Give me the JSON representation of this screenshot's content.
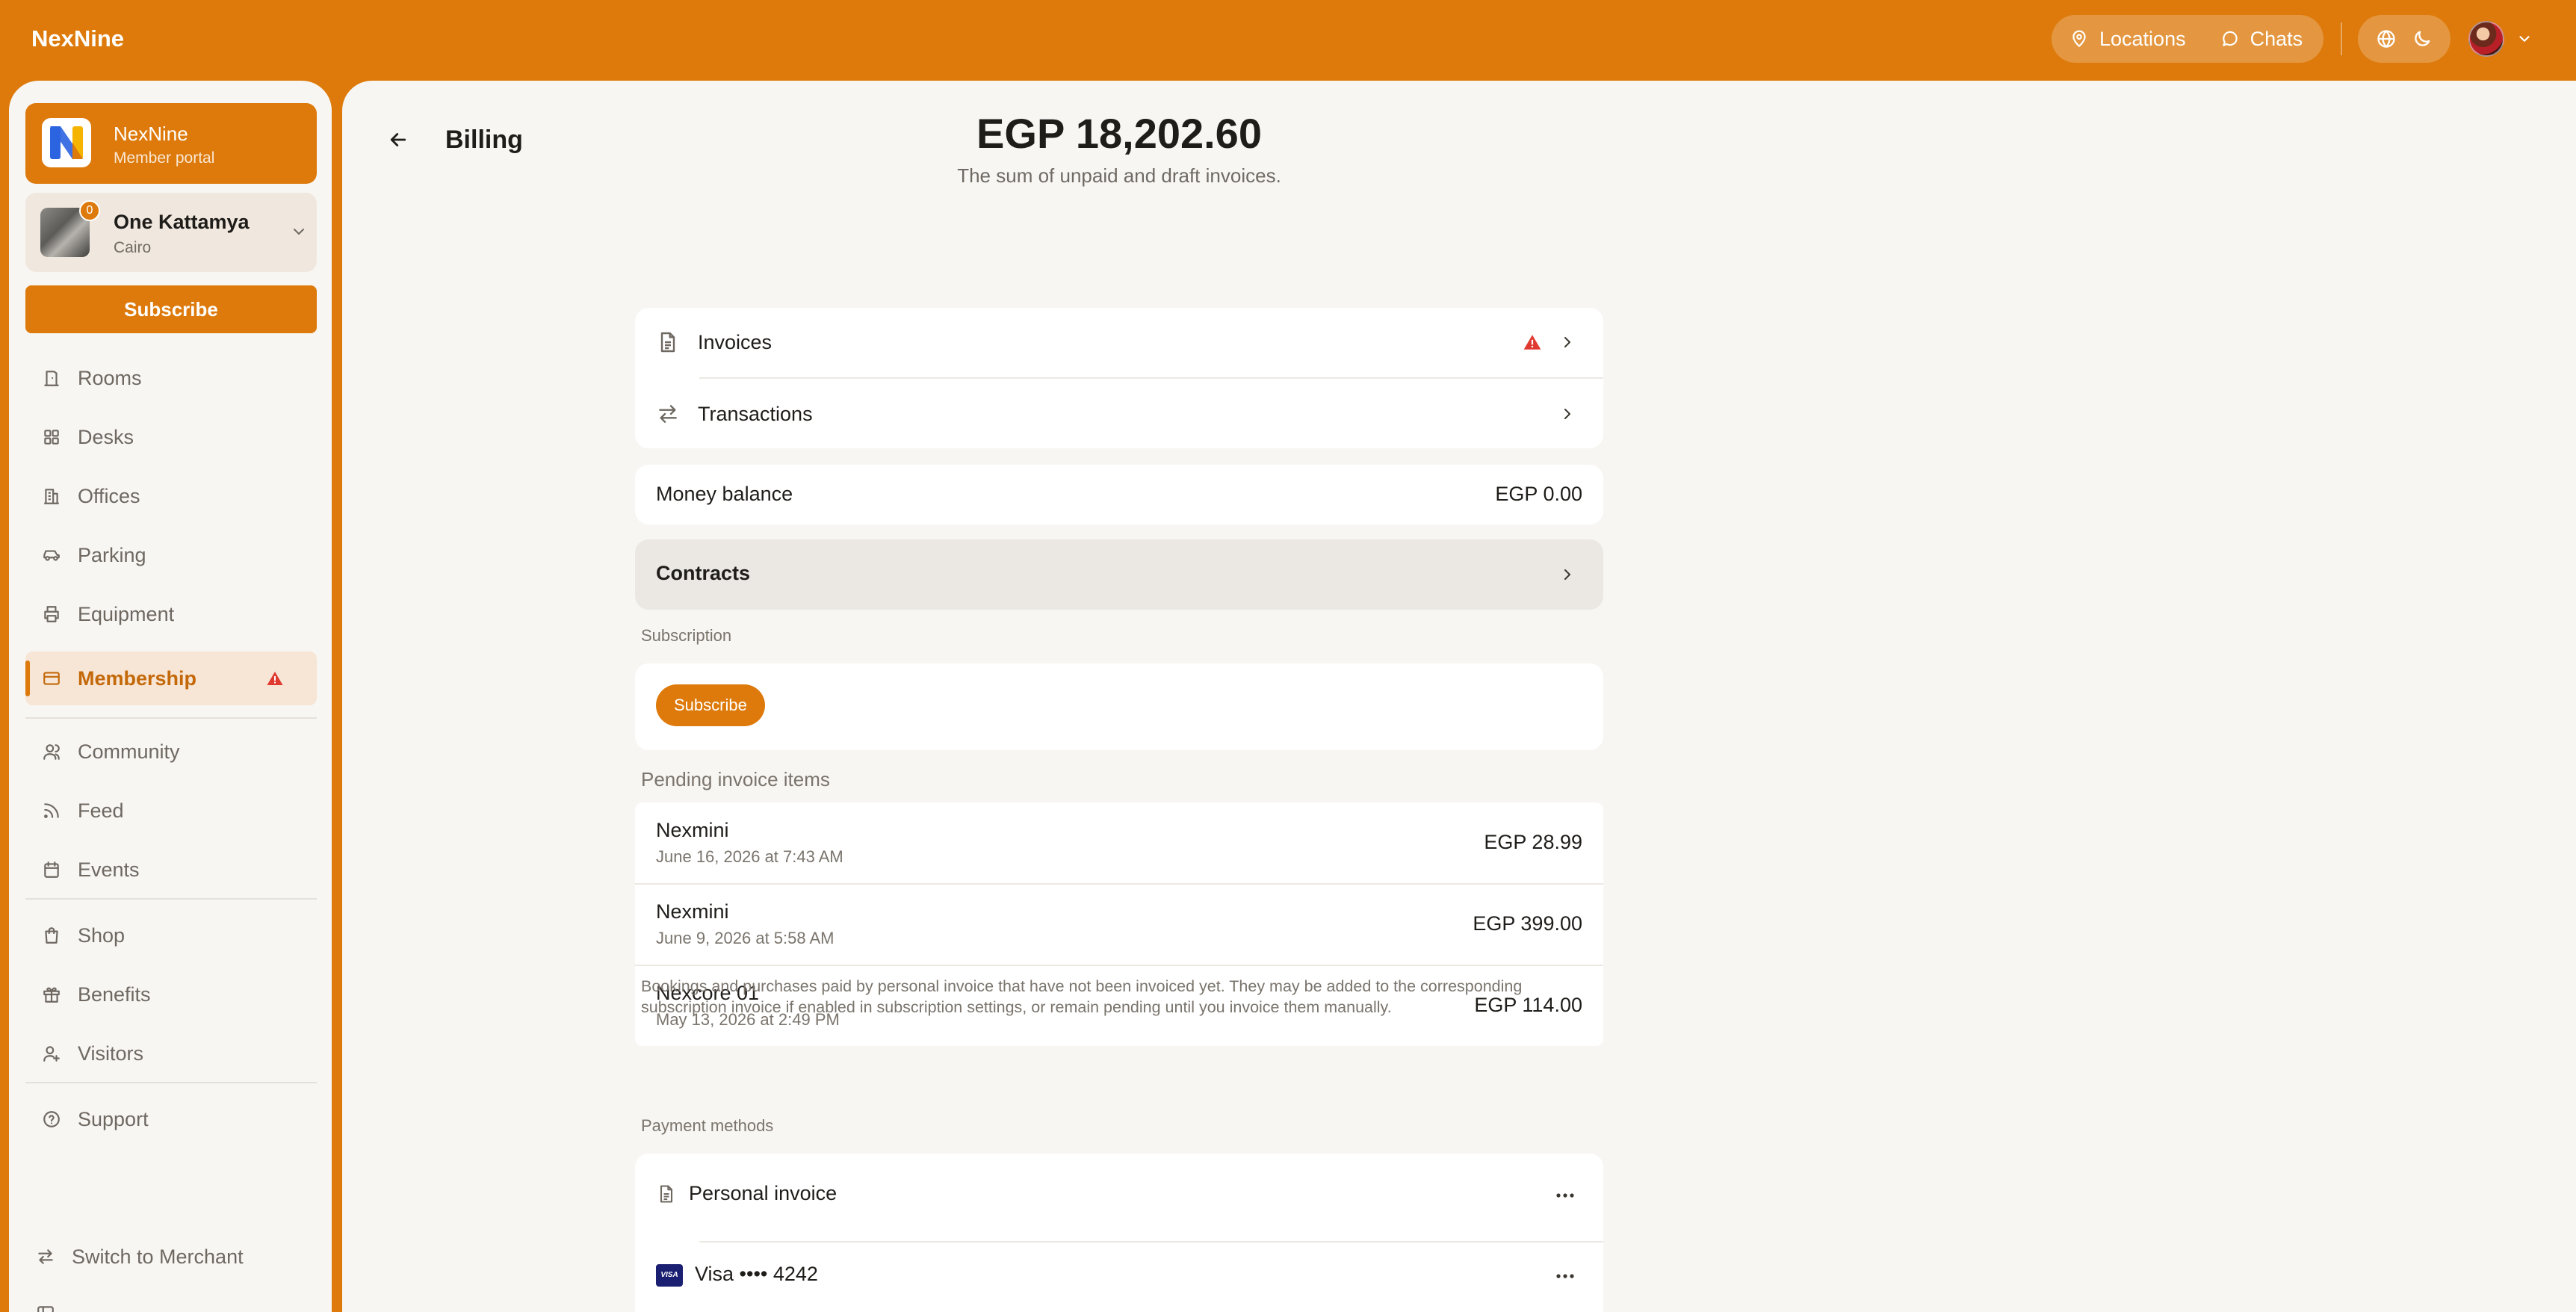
{
  "topbar": {
    "brand": "NexNine",
    "nav": [
      {
        "label": "Locations",
        "icon": "map-pin-icon"
      },
      {
        "label": "Chats",
        "icon": "chat-bubble-icon"
      }
    ],
    "tools": [
      {
        "icon": "globe-icon"
      },
      {
        "icon": "moon-icon"
      }
    ],
    "user_icon": "chevron-down-icon"
  },
  "sidebar": {
    "org": {
      "name": "NexNine",
      "subtitle": "Member portal"
    },
    "location": {
      "name": "One Kattamya",
      "city": "Cairo",
      "badge": "0"
    },
    "subscribe_label": "Subscribe",
    "items": [
      {
        "label": "Rooms",
        "icon": "door-icon"
      },
      {
        "label": "Desks",
        "icon": "grid-icon"
      },
      {
        "label": "Offices",
        "icon": "building-icon"
      },
      {
        "label": "Parking",
        "icon": "car-icon"
      },
      {
        "label": "Equipment",
        "icon": "printer-icon"
      },
      {
        "label": "Membership",
        "icon": "card-icon",
        "active": true,
        "warning": true
      },
      {
        "label": "Community",
        "icon": "users-icon"
      },
      {
        "label": "Feed",
        "icon": "rss-icon"
      },
      {
        "label": "Events",
        "icon": "calendar-icon"
      },
      {
        "label": "Shop",
        "icon": "shopping-bag-icon"
      },
      {
        "label": "Benefits",
        "icon": "gift-icon"
      },
      {
        "label": "Visitors",
        "icon": "user-plus-icon"
      },
      {
        "label": "Support",
        "icon": "help-circle-icon"
      }
    ],
    "switch_label": "Switch to Merchant"
  },
  "page": {
    "title": "Billing",
    "balance": "EGP 18,202.60",
    "balance_caption": "The sum of unpaid and draft invoices.",
    "links": [
      {
        "label": "Invoices",
        "icon": "document-icon",
        "warning": true
      },
      {
        "label": "Transactions",
        "icon": "arrows-swap-icon"
      }
    ],
    "money_balance": {
      "label": "Money balance",
      "value": "EGP 0.00"
    },
    "contracts_label": "Contracts",
    "subscription": {
      "section_label": "Subscription",
      "button": "Subscribe"
    },
    "pending": {
      "section_label": "Pending invoice items",
      "items": [
        {
          "name": "Nexmini",
          "date": "June 16, 2026 at 7:43 AM",
          "amount": "EGP 28.99"
        },
        {
          "name": "Nexmini",
          "date": "June 9, 2026 at 5:58 AM",
          "amount": "EGP 399.00"
        },
        {
          "name": "Nexcore 01",
          "date": "May 13, 2026 at 2:49 PM",
          "amount": "EGP 114.00"
        }
      ],
      "note": "Bookings and purchases paid by personal invoice that have not been invoiced yet. They may be added to the corresponding subscription invoice if enabled in subscription settings, or remain pending until you invoice them manually."
    },
    "payment_methods": {
      "section_label": "Payment methods",
      "items": [
        {
          "label": "Personal invoice",
          "icon": "document-icon"
        },
        {
          "label": "Visa •••• 4242",
          "icon": "visa-icon",
          "brand": "VISA"
        }
      ]
    }
  },
  "colors": {
    "accent": "#dd7a0b",
    "background": "#f8f6f3",
    "warning": "#e0392f"
  }
}
